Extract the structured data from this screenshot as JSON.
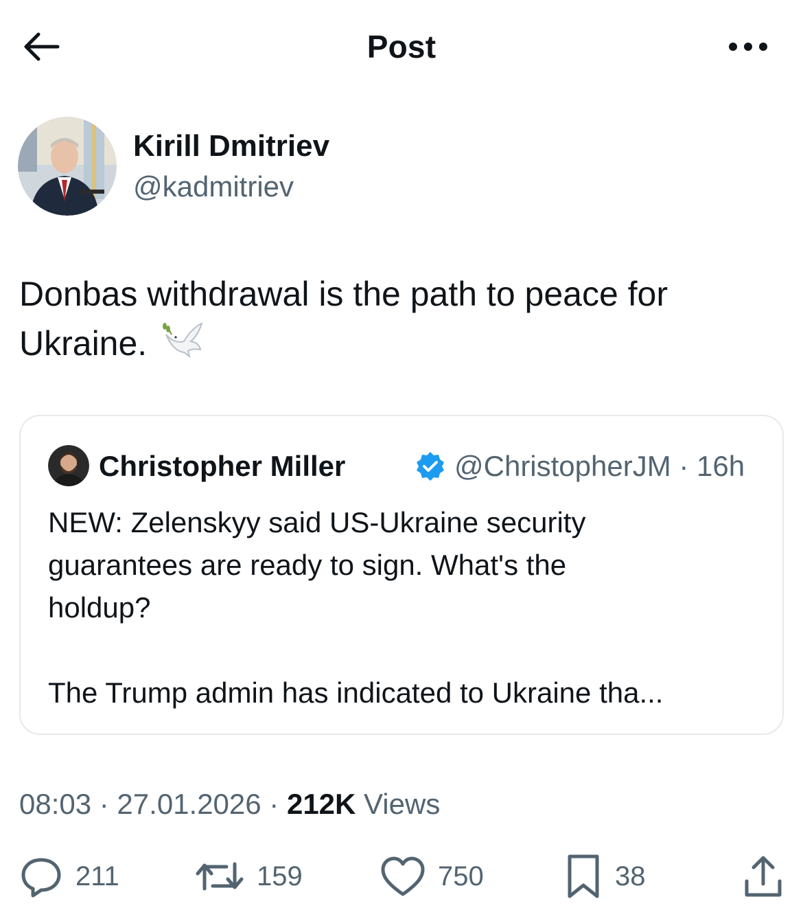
{
  "header": {
    "title": "Post",
    "back_icon": "arrow-left-icon",
    "more_icon": "more-horizontal-icon"
  },
  "author": {
    "name": "Kirill Dmitriev",
    "handle": "@kadmitriev"
  },
  "post": {
    "text_line1": "Donbas withdrawal is the path to peace for",
    "text_line2": "Ukraine.",
    "emoji": "dove-icon"
  },
  "quote": {
    "name": "Christopher Miller",
    "handle_time": "@ChristopherJM · 16h",
    "verified_color": "#1d9bf0",
    "line1": "NEW: Zelenskyy said US-Ukraine security",
    "line2": "guarantees are ready to sign. What's the",
    "line3": "holdup?",
    "line4": "The Trump admin has indicated to Ukraine tha..."
  },
  "meta": {
    "time_date": "08:03 · 27.01.2026 · ",
    "views_count": "212K",
    "views_label": " Views"
  },
  "actions": {
    "replies": "211",
    "reposts": "159",
    "likes": "750",
    "bookmarks": "38"
  },
  "colors": {
    "text": "#0f1419",
    "secondary": "#536471",
    "border": "#e6e9ec",
    "accent": "#1d9bf0"
  }
}
